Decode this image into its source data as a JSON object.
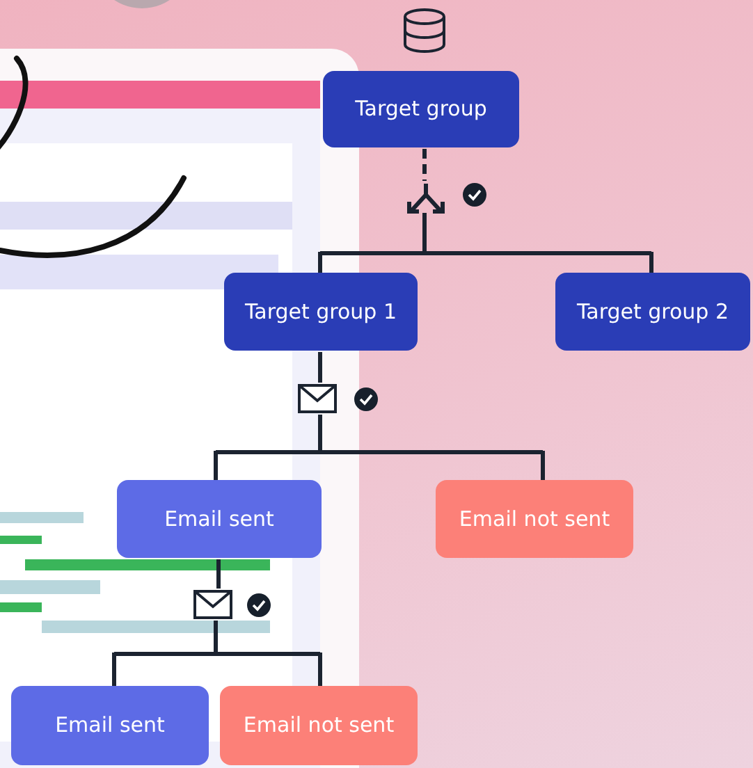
{
  "nodes": [
    {
      "text": "Target group",
      "kind": "group"
    },
    {
      "text": "Target group 1",
      "kind": "group"
    },
    {
      "text": "Target group 2",
      "kind": "group"
    },
    {
      "text": "Email sent",
      "kind": "sent"
    },
    {
      "text": "Email not sent",
      "kind": "not_sent"
    },
    {
      "text": "Email sent",
      "kind": "sent"
    },
    {
      "text": "Email not sent",
      "kind": "not_sent"
    }
  ],
  "steps": [
    {
      "kind": "split",
      "checked": true
    },
    {
      "kind": "email",
      "checked": true
    },
    {
      "kind": "email",
      "checked": true
    }
  ]
}
